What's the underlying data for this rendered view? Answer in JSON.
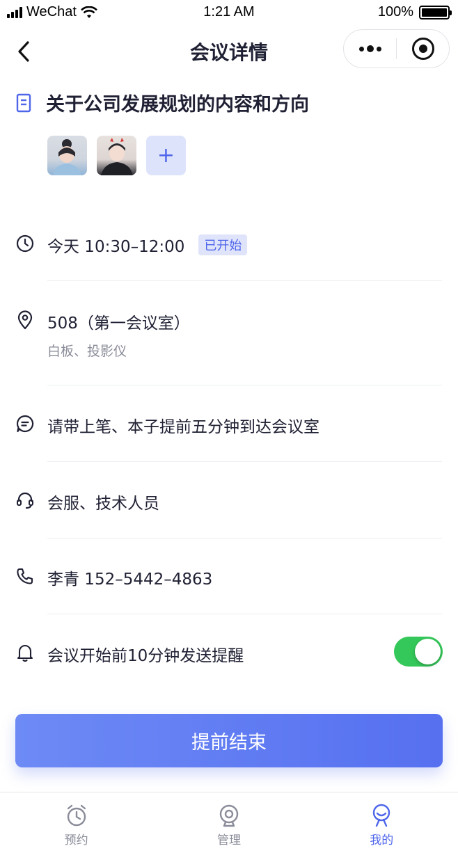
{
  "status_bar": {
    "carrier": "WeChat",
    "time": "1:21 AM",
    "battery": "100%"
  },
  "nav": {
    "title": "会议详情",
    "icons": [
      "back-icon",
      "more-icon",
      "target-icon"
    ]
  },
  "meeting": {
    "title": "关于公司发展规划的内容和方向",
    "attendees_add": "+",
    "time_text": "今天 10:30–12:00",
    "status_badge": "已开始",
    "location": "508（第一会议室）",
    "equipment": "白板、投影仪",
    "note": "请带上笔、本子提前五分钟到达会议室",
    "services": "会服、技术人员",
    "contact": "李青 152–5442–4863",
    "reminder": "会议开始前10分钟发送提醒",
    "reminder_enabled": true
  },
  "actions": {
    "end_label": "提前结束"
  },
  "colors": {
    "accent": "#4f66ea",
    "badge_bg": "#dfe4fb",
    "toggle_on": "#34c759",
    "button_start": "#6d8af5",
    "button_end": "#5670f0"
  },
  "tabbar": {
    "tabs": [
      {
        "label": "预约",
        "icon": "alarm-clock-icon",
        "active": false
      },
      {
        "label": "管理",
        "icon": "webcam-icon",
        "active": false
      },
      {
        "label": "我的",
        "icon": "profile-icon",
        "active": true
      }
    ]
  }
}
